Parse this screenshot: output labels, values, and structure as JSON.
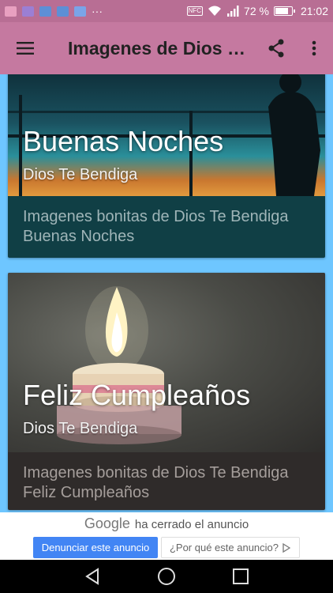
{
  "status_bar": {
    "battery_percent": "72 %",
    "battery_level": 0.72,
    "time": "21:02",
    "more": "···",
    "nfc": "NFC",
    "icon_colors": [
      "#e8a0c0",
      "#9b7fd4",
      "#5d8fd6",
      "#5d8fd6",
      "#7aa4e8"
    ]
  },
  "toolbar": {
    "title": "Imagenes de Dios T…"
  },
  "cards": [
    {
      "title": "Buenas Noches",
      "subtitle": "Dios Te Bendiga",
      "description": "Imagenes bonitas de Dios Te Bendiga Buenas Noches"
    },
    {
      "title": "Feliz Cumpleaños",
      "subtitle": "Dios Te Bendiga",
      "description": "Imagenes bonitas de Dios Te Bendiga Feliz Cumpleaños"
    }
  ],
  "ad": {
    "brand": "Google",
    "closed_text": "ha cerrado el anuncio",
    "report_label": "Denunciar este anuncio",
    "why_label": "¿Por qué este anuncio?"
  },
  "colors": {
    "status_bar": "#b86e94",
    "toolbar": "#c579a0",
    "background": "#6ec6ff",
    "ad_button": "#4285f4"
  }
}
